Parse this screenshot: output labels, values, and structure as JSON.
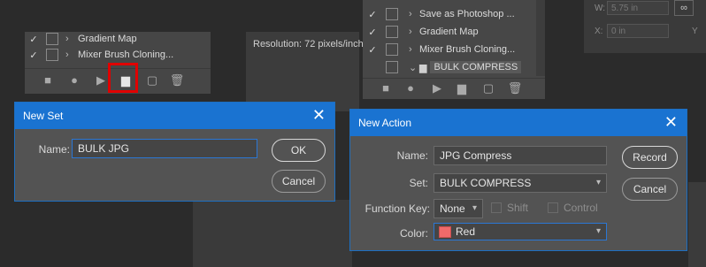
{
  "left_panel": {
    "rows": [
      {
        "check": "✓",
        "label": "Gradient Map"
      },
      {
        "check": "✓",
        "label": "Mixer Brush Cloning..."
      }
    ],
    "toolbar": {
      "stop": "■",
      "record": "●",
      "play": "▶",
      "new_set": "▆",
      "new_action": "▢",
      "delete": "🗑"
    }
  },
  "resolution_text": "Resolution: 72 pixels/inch",
  "right_panel": {
    "rows": [
      {
        "check": "✓",
        "label": "Save as Photoshop ..."
      },
      {
        "check": "✓",
        "label": "Gradient Map"
      },
      {
        "check": "✓",
        "label": "Mixer Brush Cloning..."
      },
      {
        "check": "",
        "label": "BULK COMPRESS"
      }
    ],
    "toolbar": {
      "stop": "■",
      "record": "●",
      "play": "▶",
      "new_set": "▆",
      "new_action": "▢",
      "delete": "🗑"
    }
  },
  "properties": {
    "w_label": "W:",
    "w_value": "5.75 in",
    "x_label": "X:",
    "x_value": "0 in",
    "y_label": "Y"
  },
  "new_set_dialog": {
    "title": "New Set",
    "close": "✕",
    "name_label": "Name:",
    "name_value": "BULK JPG",
    "ok_label": "OK",
    "cancel_label": "Cancel"
  },
  "new_action_dialog": {
    "title": "New Action",
    "close": "✕",
    "name_label": "Name:",
    "name_value": "JPG Compress",
    "set_label": "Set:",
    "set_value": "BULK COMPRESS",
    "function_key_label": "Function Key:",
    "function_key_value": "None",
    "shift_label": "Shift",
    "control_label": "Control",
    "color_label": "Color:",
    "color_value": "Red",
    "color_swatch": "#f06a6a",
    "record_label": "Record",
    "cancel_label": "Cancel"
  },
  "colors": {
    "accent": "#1a73d1",
    "highlight": "#e00000"
  }
}
